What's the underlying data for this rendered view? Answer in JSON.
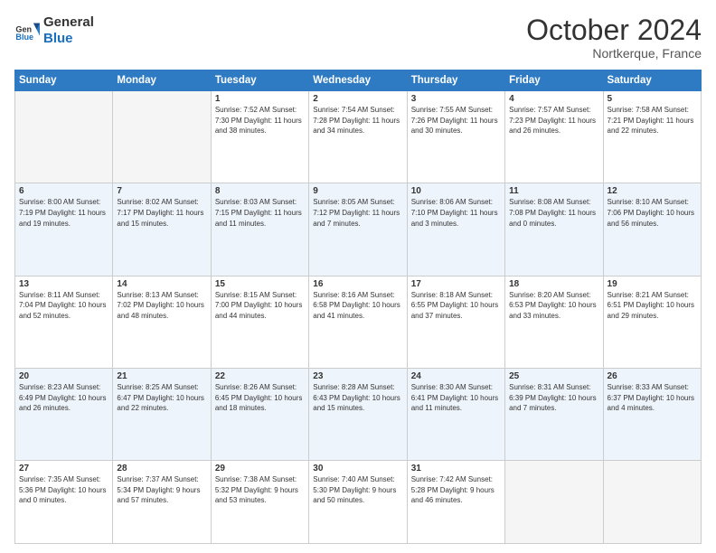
{
  "header": {
    "logo_general": "General",
    "logo_blue": "Blue",
    "month": "October 2024",
    "location": "Nortkerque, France"
  },
  "weekdays": [
    "Sunday",
    "Monday",
    "Tuesday",
    "Wednesday",
    "Thursday",
    "Friday",
    "Saturday"
  ],
  "weeks": [
    [
      {
        "day": "",
        "info": ""
      },
      {
        "day": "",
        "info": ""
      },
      {
        "day": "1",
        "info": "Sunrise: 7:52 AM\nSunset: 7:30 PM\nDaylight: 11 hours and 38 minutes."
      },
      {
        "day": "2",
        "info": "Sunrise: 7:54 AM\nSunset: 7:28 PM\nDaylight: 11 hours and 34 minutes."
      },
      {
        "day": "3",
        "info": "Sunrise: 7:55 AM\nSunset: 7:26 PM\nDaylight: 11 hours and 30 minutes."
      },
      {
        "day": "4",
        "info": "Sunrise: 7:57 AM\nSunset: 7:23 PM\nDaylight: 11 hours and 26 minutes."
      },
      {
        "day": "5",
        "info": "Sunrise: 7:58 AM\nSunset: 7:21 PM\nDaylight: 11 hours and 22 minutes."
      }
    ],
    [
      {
        "day": "6",
        "info": "Sunrise: 8:00 AM\nSunset: 7:19 PM\nDaylight: 11 hours and 19 minutes."
      },
      {
        "day": "7",
        "info": "Sunrise: 8:02 AM\nSunset: 7:17 PM\nDaylight: 11 hours and 15 minutes."
      },
      {
        "day": "8",
        "info": "Sunrise: 8:03 AM\nSunset: 7:15 PM\nDaylight: 11 hours and 11 minutes."
      },
      {
        "day": "9",
        "info": "Sunrise: 8:05 AM\nSunset: 7:12 PM\nDaylight: 11 hours and 7 minutes."
      },
      {
        "day": "10",
        "info": "Sunrise: 8:06 AM\nSunset: 7:10 PM\nDaylight: 11 hours and 3 minutes."
      },
      {
        "day": "11",
        "info": "Sunrise: 8:08 AM\nSunset: 7:08 PM\nDaylight: 11 hours and 0 minutes."
      },
      {
        "day": "12",
        "info": "Sunrise: 8:10 AM\nSunset: 7:06 PM\nDaylight: 10 hours and 56 minutes."
      }
    ],
    [
      {
        "day": "13",
        "info": "Sunrise: 8:11 AM\nSunset: 7:04 PM\nDaylight: 10 hours and 52 minutes."
      },
      {
        "day": "14",
        "info": "Sunrise: 8:13 AM\nSunset: 7:02 PM\nDaylight: 10 hours and 48 minutes."
      },
      {
        "day": "15",
        "info": "Sunrise: 8:15 AM\nSunset: 7:00 PM\nDaylight: 10 hours and 44 minutes."
      },
      {
        "day": "16",
        "info": "Sunrise: 8:16 AM\nSunset: 6:58 PM\nDaylight: 10 hours and 41 minutes."
      },
      {
        "day": "17",
        "info": "Sunrise: 8:18 AM\nSunset: 6:55 PM\nDaylight: 10 hours and 37 minutes."
      },
      {
        "day": "18",
        "info": "Sunrise: 8:20 AM\nSunset: 6:53 PM\nDaylight: 10 hours and 33 minutes."
      },
      {
        "day": "19",
        "info": "Sunrise: 8:21 AM\nSunset: 6:51 PM\nDaylight: 10 hours and 29 minutes."
      }
    ],
    [
      {
        "day": "20",
        "info": "Sunrise: 8:23 AM\nSunset: 6:49 PM\nDaylight: 10 hours and 26 minutes."
      },
      {
        "day": "21",
        "info": "Sunrise: 8:25 AM\nSunset: 6:47 PM\nDaylight: 10 hours and 22 minutes."
      },
      {
        "day": "22",
        "info": "Sunrise: 8:26 AM\nSunset: 6:45 PM\nDaylight: 10 hours and 18 minutes."
      },
      {
        "day": "23",
        "info": "Sunrise: 8:28 AM\nSunset: 6:43 PM\nDaylight: 10 hours and 15 minutes."
      },
      {
        "day": "24",
        "info": "Sunrise: 8:30 AM\nSunset: 6:41 PM\nDaylight: 10 hours and 11 minutes."
      },
      {
        "day": "25",
        "info": "Sunrise: 8:31 AM\nSunset: 6:39 PM\nDaylight: 10 hours and 7 minutes."
      },
      {
        "day": "26",
        "info": "Sunrise: 8:33 AM\nSunset: 6:37 PM\nDaylight: 10 hours and 4 minutes."
      }
    ],
    [
      {
        "day": "27",
        "info": "Sunrise: 7:35 AM\nSunset: 5:36 PM\nDaylight: 10 hours and 0 minutes."
      },
      {
        "day": "28",
        "info": "Sunrise: 7:37 AM\nSunset: 5:34 PM\nDaylight: 9 hours and 57 minutes."
      },
      {
        "day": "29",
        "info": "Sunrise: 7:38 AM\nSunset: 5:32 PM\nDaylight: 9 hours and 53 minutes."
      },
      {
        "day": "30",
        "info": "Sunrise: 7:40 AM\nSunset: 5:30 PM\nDaylight: 9 hours and 50 minutes."
      },
      {
        "day": "31",
        "info": "Sunrise: 7:42 AM\nSunset: 5:28 PM\nDaylight: 9 hours and 46 minutes."
      },
      {
        "day": "",
        "info": ""
      },
      {
        "day": "",
        "info": ""
      }
    ]
  ]
}
